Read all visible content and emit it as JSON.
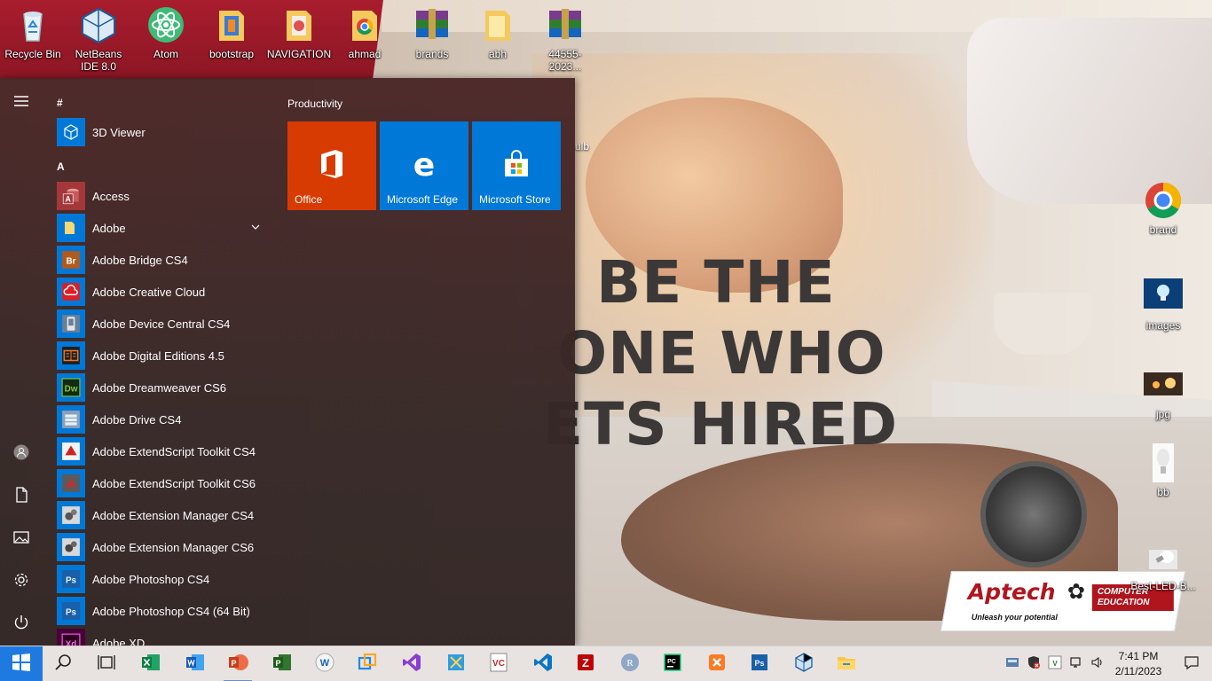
{
  "desktop": {
    "slogan": [
      "BE THE",
      "ONE WHO",
      "ETS HIRED"
    ],
    "partial_label": "ulb",
    "aptech": {
      "brand": "Aptech",
      "edu_line1": "COMPUTER",
      "edu_line2": "EDUCATION",
      "tagline": "Unleash your potential"
    },
    "top_icons": [
      {
        "label": "Recycle Bin",
        "icon": "recycle-bin-icon"
      },
      {
        "label": "NetBeans IDE 8.0",
        "icon": "netbeans-icon"
      },
      {
        "label": "Atom",
        "icon": "atom-icon"
      },
      {
        "label": "bootstrap",
        "icon": "folder-icon"
      },
      {
        "label": "NAVIGATION",
        "icon": "folder-icon"
      },
      {
        "label": "ahmad",
        "icon": "chrome-folder-icon"
      },
      {
        "label": "brands",
        "icon": "winrar-icon"
      },
      {
        "label": "abh",
        "icon": "folder-icon"
      },
      {
        "label": "44555-2023...",
        "icon": "winrar-icon"
      }
    ],
    "right_icons": [
      {
        "label": "brand",
        "icon": "chrome-icon"
      },
      {
        "label": "images",
        "icon": "image-icon"
      },
      {
        "label": "jpg",
        "icon": "image-icon"
      },
      {
        "label": "bb",
        "icon": "image-icon"
      },
      {
        "label": "Best-LED-B...",
        "icon": "image-icon"
      }
    ]
  },
  "start_menu": {
    "rail": [
      "hamburger-icon",
      "user-icon",
      "documents-icon",
      "pictures-icon",
      "settings-icon",
      "power-icon"
    ],
    "groups": [
      {
        "letter": "#",
        "apps": [
          {
            "label": "3D Viewer",
            "icon": "3d-viewer-icon",
            "color": "#0078d7"
          }
        ]
      },
      {
        "letter": "A",
        "apps": [
          {
            "label": "Access",
            "icon": "access-icon",
            "color": "#a4373a"
          },
          {
            "label": "Adobe",
            "icon": "folder-icon",
            "color": "#0078d7",
            "expandable": true
          },
          {
            "label": "Adobe Bridge CS4",
            "icon": "bridge-icon",
            "color": "#0078d7",
            "abbr": "Br"
          },
          {
            "label": "Adobe Creative Cloud",
            "icon": "creative-cloud-icon",
            "color": "#0078d7"
          },
          {
            "label": "Adobe Device Central CS4",
            "icon": "device-central-icon",
            "color": "#0078d7"
          },
          {
            "label": "Adobe Digital Editions 4.5",
            "icon": "digital-editions-icon",
            "color": "#0078d7"
          },
          {
            "label": "Adobe Dreamweaver CS6",
            "icon": "dreamweaver-icon",
            "color": "#0078d7",
            "abbr": "Dw"
          },
          {
            "label": "Adobe Drive CS4",
            "icon": "drive-icon",
            "color": "#0078d7"
          },
          {
            "label": "Adobe ExtendScript Toolkit CS4",
            "icon": "extendscript-icon",
            "color": "#0078d7"
          },
          {
            "label": "Adobe ExtendScript Toolkit CS6",
            "icon": "extendscript-icon",
            "color": "#0078d7"
          },
          {
            "label": "Adobe Extension Manager CS4",
            "icon": "extension-manager-icon",
            "color": "#0078d7"
          },
          {
            "label": "Adobe Extension Manager CS6",
            "icon": "extension-manager-icon",
            "color": "#0078d7"
          },
          {
            "label": "Adobe Photoshop CS4",
            "icon": "photoshop-icon",
            "color": "#0078d7",
            "abbr": "Ps"
          },
          {
            "label": "Adobe Photoshop CS4 (64 Bit)",
            "icon": "photoshop-icon",
            "color": "#0078d7",
            "abbr": "Ps"
          },
          {
            "label": "Adobe XD",
            "icon": "xd-icon",
            "color": "#470137",
            "abbr": "Xd"
          }
        ]
      }
    ],
    "tiles": {
      "group_title": "Productivity",
      "items": [
        {
          "label": "Office",
          "icon": "office-icon",
          "color": "#d83b01"
        },
        {
          "label": "Microsoft Edge",
          "icon": "edge-icon",
          "color": "#0078d7"
        },
        {
          "label": "Microsoft Store",
          "icon": "store-icon",
          "color": "#0078d7"
        }
      ]
    }
  },
  "taskbar": {
    "start": "windows-start-icon",
    "search": "search-icon",
    "task_view": "task-view-icon",
    "apps": [
      "excel-icon",
      "word-icon",
      "powerpoint-icon",
      "project-icon",
      "wordpad-icon",
      "virtualbox-icon",
      "visual-studio-icon",
      "snip-tool-icon",
      "visual-studio-code-old-icon",
      "vscode-icon",
      "filezilla-icon",
      "r-icon",
      "pycharm-icon",
      "xampp-icon",
      "photoshop-icon",
      "netbeans-icon",
      "file-explorer-icon"
    ],
    "tray": [
      "network-card-icon",
      "defender-icon",
      "vscode-tray-icon",
      "network-icon",
      "volume-icon"
    ],
    "time": "7:41 PM",
    "date": "2/11/2023",
    "notifications": "action-center-icon"
  }
}
